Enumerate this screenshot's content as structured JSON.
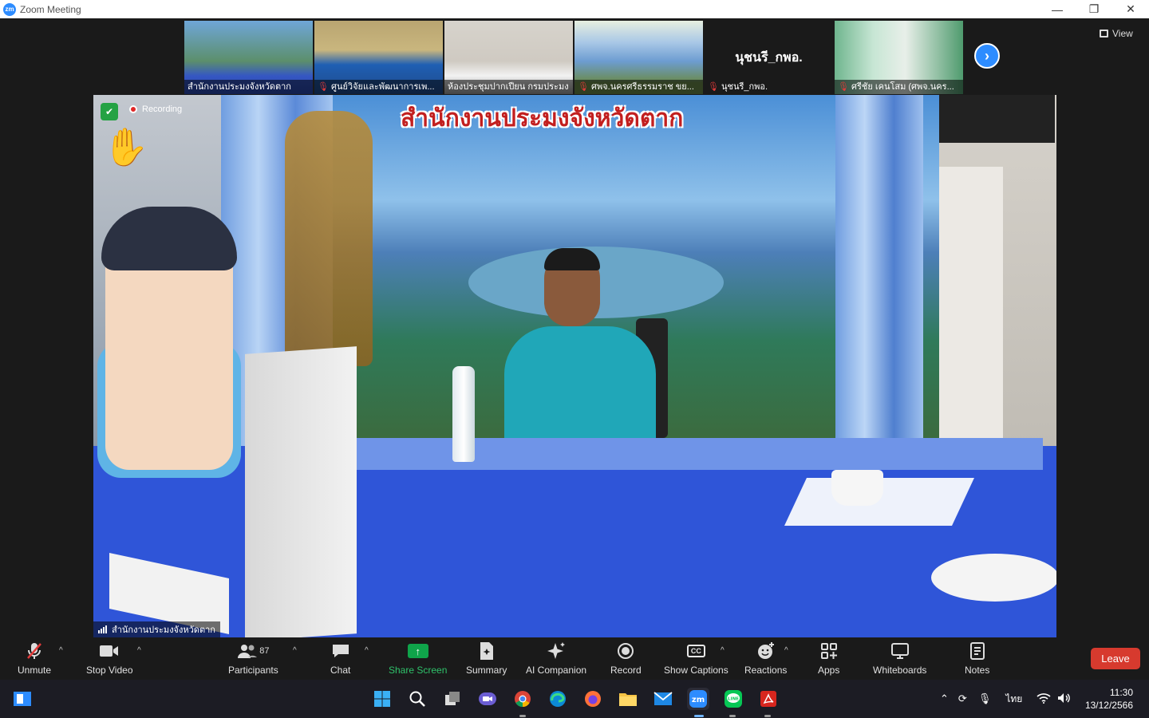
{
  "window": {
    "title": "Zoom Meeting",
    "minimize": "—",
    "restore": "❐",
    "close": "✕"
  },
  "thumbnails": [
    {
      "label": "สำนักงานประมงจังหวัดตาก",
      "muted": false,
      "active": true
    },
    {
      "label": "ศูนย์วิจัยและพัฒนาการเพ...",
      "muted": true,
      "active": false
    },
    {
      "label": "ห้องประชุมปากเปียน กรมประมง",
      "muted": false,
      "active": false
    },
    {
      "label": "ศพจ.นครศรีธรรมราช ขย...",
      "muted": true,
      "active": false
    },
    {
      "label": "นุชนรี_กพอ.",
      "muted": true,
      "active": false,
      "name_only": "นุชนรี_กพอ."
    },
    {
      "label": "ศรีชัย เคนโสม (ศพจ.นคร...",
      "muted": true,
      "active": false
    }
  ],
  "view_button": {
    "label": "View"
  },
  "main_video": {
    "banner": "สำนักงานประมงจังหวัดตาก",
    "recording_label": "Recording",
    "participant_label": "สำนักงานประมงจังหวัดตาก"
  },
  "toolbar": {
    "unmute": "Unmute",
    "stop_video": "Stop Video",
    "participants": "Participants",
    "participants_count": "87",
    "chat": "Chat",
    "share_screen": "Share Screen",
    "summary": "Summary",
    "ai_companion": "AI Companion",
    "record": "Record",
    "show_captions": "Show Captions",
    "captions_icon": "CC",
    "reactions": "Reactions",
    "apps": "Apps",
    "whiteboards": "Whiteboards",
    "notes": "Notes",
    "leave": "Leave"
  },
  "taskbar": {
    "language": "ไทย",
    "time": "11:30",
    "date": "13/12/2566"
  },
  "colors": {
    "zoom_blue": "#2d8cff",
    "share_green": "#0fa44a",
    "leave_red": "#d73a2e",
    "active_border": "#f5c518"
  }
}
